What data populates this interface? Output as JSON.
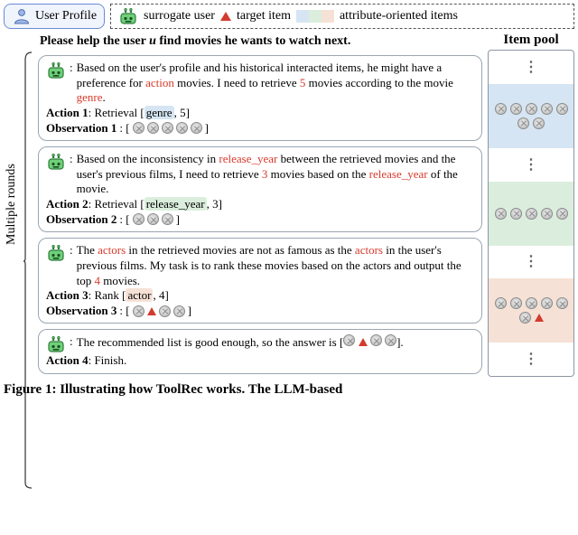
{
  "legend": {
    "user_profile": "User Profile",
    "surrogate": "surrogate user",
    "target": "target item",
    "attr_items": "attribute-oriented items"
  },
  "rounds_label": "Multiple rounds",
  "prompt": {
    "prefix": "Please help the user ",
    "user_var": "u",
    "suffix": " find movies he wants to watch next."
  },
  "pool_header": "Item pool",
  "bubbles": [
    {
      "text_html": "Based on the user's profile and his historical interacted items, he might have a preference for <span class=\"hl-red\">action</span> movies. I need to retrieve <span class=\"hl-red\">5</span> movies according to the movie <span class=\"hl-red\">genre</span>.",
      "action_label": "Action 1",
      "action_value": ": Retrieval [",
      "action_attr": "genre",
      "action_attr_class": "hl-genre",
      "action_tail": ", 5]",
      "obs_label": "Observation 1",
      "obs_tokens": 5
    },
    {
      "text_html": "Based on the inconsistency in <span class=\"hl-red\">release_year</span> between the retrieved movies and the user's previous films, I need to retrieve <span class=\"hl-red\">3</span> movies based on the <span class=\"hl-red\">release_year</span> of the movie.",
      "action_label": "Action 2",
      "action_value": ": Retrieval [",
      "action_attr": "release_year",
      "action_attr_class": "hl-year",
      "action_tail": ", 3]",
      "obs_label": "Observation 2",
      "obs_tokens": 3
    },
    {
      "text_html": "The <span class=\"hl-red\">actors</span> in the retrieved movies are not as famous as the <span class=\"hl-red\">actors</span> in the user's previous films. My task is to rank these movies based on the actors and output the top <span class=\"hl-red\">4</span> movies.",
      "action_label": "Action 3",
      "action_value": ": Rank [",
      "action_attr": "actor",
      "action_attr_class": "hl-actor",
      "action_tail": ", 4]",
      "obs_label": "Observation 3",
      "obs_seq": [
        "movie",
        "triangle",
        "movie",
        "movie"
      ]
    },
    {
      "text_html": "The recommended list is good enough, so the answer is [<span class=\"movie-token\"></span> <span class=\"triangle-icon small\"></span> <span class=\"movie-token\"></span> <span class=\"movie-token\"></span>].",
      "action_label": "Action 4",
      "action_plain": ": Finish."
    }
  ],
  "caption": "Figure 1: Illustrating how ToolRec works. The LLM-based",
  "colors": {
    "blue": "#d6e5f3",
    "green": "#dbeedd",
    "orange": "#f6e1d6",
    "red": "#d83a2c"
  }
}
